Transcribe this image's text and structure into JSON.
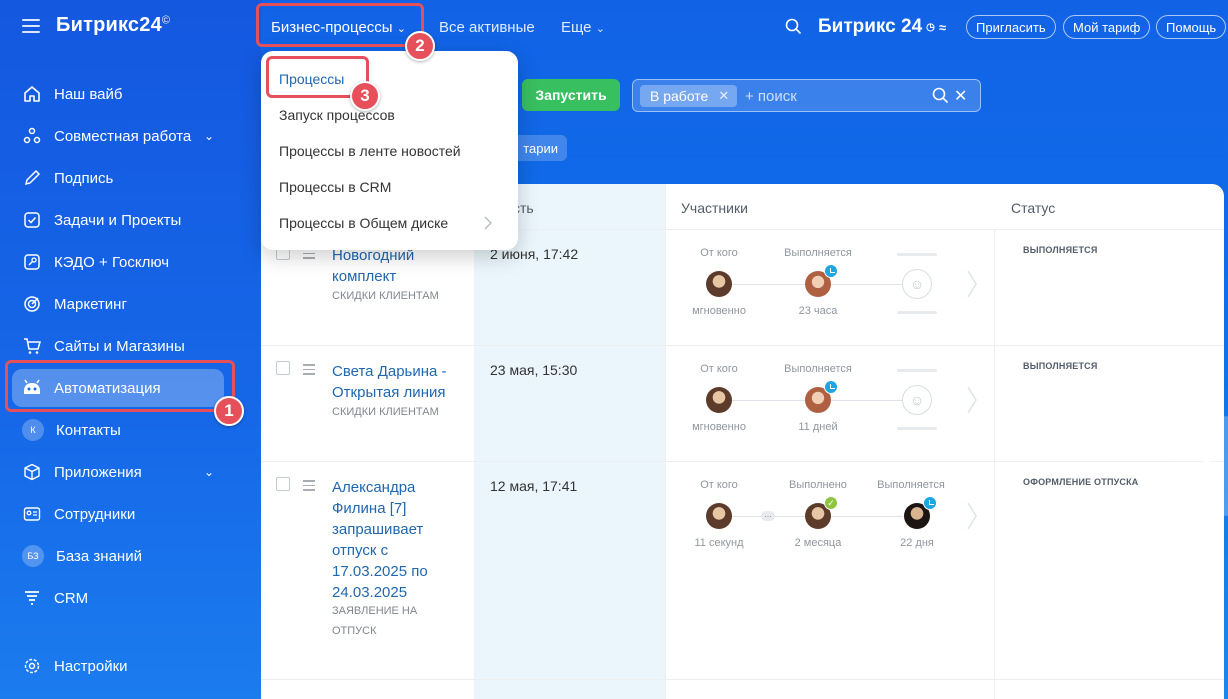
{
  "app": {
    "logo": "Битрикс24",
    "logo_mark": "©"
  },
  "sidebar": {
    "items": [
      {
        "label": "Наш вайб",
        "icon": "home-icon"
      },
      {
        "label": "Совместная работа",
        "icon": "collaboration-icon",
        "has_chevron": true
      },
      {
        "label": "Подпись",
        "icon": "signature-icon"
      },
      {
        "label": "Задачи и Проекты",
        "icon": "tasks-icon"
      },
      {
        "label": "КЭДО + Госключ",
        "icon": "key-icon"
      },
      {
        "label": "Маркетинг",
        "icon": "marketing-icon"
      },
      {
        "label": "Сайты и Магазины",
        "icon": "cart-icon"
      },
      {
        "label": "Автоматизация",
        "icon": "robot-icon",
        "active": true
      },
      {
        "label": "Контакты",
        "icon": "contacts-icon",
        "avatar_text": "К"
      },
      {
        "label": "Приложения",
        "icon": "box-icon",
        "has_chevron": true
      },
      {
        "label": "Сотрудники",
        "icon": "employees-icon"
      },
      {
        "label": "База знаний",
        "icon": "knowledge-icon",
        "avatar_text": "БЗ"
      },
      {
        "label": "CRM",
        "icon": "crm-icon"
      }
    ],
    "settings_label": "Настройки"
  },
  "topbar": {
    "biz_processes": "Бизнес-процессы",
    "all_active": "Все активные",
    "more": "Еще",
    "logo": "Битрикс 24",
    "invite": "Пригласить",
    "my_plan": "Мой тариф",
    "help": "Помощь"
  },
  "controls": {
    "start_button": "Запустить",
    "filter_chip": "В работе",
    "search_placeholder": "+ поиск",
    "comments_partial": "тарии"
  },
  "dropdown": {
    "items": [
      "Процессы",
      "Запуск процессов",
      "Процессы в ленте новостей",
      "Процессы в CRM",
      "Процессы в Общем диске"
    ]
  },
  "annotations": {
    "step1": "1",
    "step2": "2",
    "step3": "3"
  },
  "table": {
    "headers": {
      "activity": "вность",
      "participants": "Участники",
      "status": "Статус"
    },
    "rows": [
      {
        "title": "Новогодний комплект",
        "subtitle": "СКИДКИ КЛИЕНТАМ",
        "date": "2 июня, 17:42",
        "from_label": "От кого",
        "from_time": "мгновенно",
        "mid_label": "Выполняется",
        "mid_time": "23 часа",
        "status": "ВЫПОЛНЯЕТСЯ"
      },
      {
        "title": "Света Дарьина - Открытая линия",
        "subtitle": "СКИДКИ КЛИЕНТАМ",
        "date": "23 мая, 15:30",
        "from_label": "От кого",
        "from_time": "мгновенно",
        "mid_label": "Выполняется",
        "mid_time": "11 дней",
        "status": "ВЫПОЛНЯЕТСЯ"
      },
      {
        "title": "Александра Филина [7] запрашивает отпуск с 17.03.2025 по 24.03.2025",
        "subtitle": "ЗАЯВЛЕНИЕ НА ОТПУСК",
        "date": "12 мая, 17:41",
        "from_label": "От кого",
        "from_time": "11 секунд",
        "mid_label": "Выполнено",
        "mid_time": "2 месяца",
        "last_label": "Выполняется",
        "last_time": "22 дня",
        "status": "ОФОРМЛЕНИЕ ОТПУСКА"
      }
    ]
  }
}
